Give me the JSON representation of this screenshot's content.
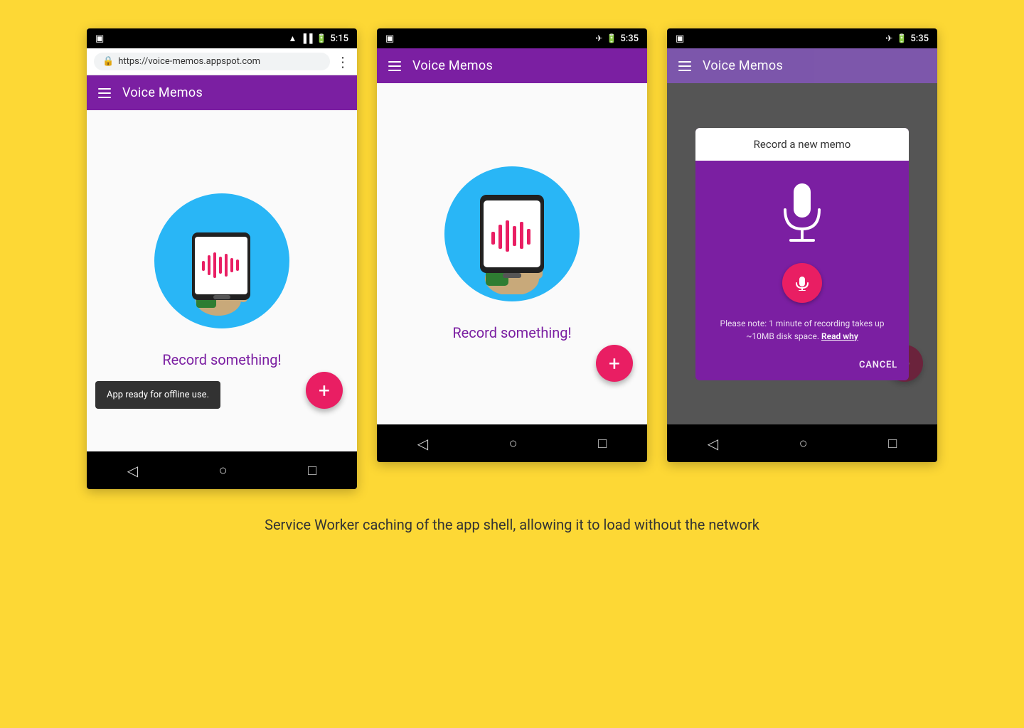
{
  "page": {
    "background": "#FDD835",
    "caption": "Service Worker caching of the app shell, allowing it to load without the network"
  },
  "phone1": {
    "statusBar": {
      "time": "5:15",
      "hasSim": true,
      "hasWifi": true,
      "hasBattery": true
    },
    "chromeBar": {
      "url": "https://voice-memos.appspot.com",
      "hasLock": true
    },
    "toolbar": {
      "title": "Voice Memos"
    },
    "content": {
      "recordLabel": "Record something!"
    },
    "snackbar": {
      "text": "App ready for offline use."
    },
    "fab": {
      "label": "+"
    },
    "nav": {
      "back": "◁",
      "home": "○",
      "recent": "□"
    }
  },
  "phone2": {
    "statusBar": {
      "time": "5:35",
      "hasAirplane": true,
      "hasBattery": true
    },
    "toolbar": {
      "title": "Voice Memos"
    },
    "content": {
      "recordLabel": "Record something!"
    },
    "fab": {
      "label": "+"
    },
    "nav": {
      "back": "◁",
      "home": "○",
      "recent": "□"
    }
  },
  "phone3": {
    "statusBar": {
      "time": "5:35",
      "hasAirplane": true,
      "hasBattery": true
    },
    "toolbar": {
      "title": "Voice Memos"
    },
    "dialog": {
      "title": "Record a new memo",
      "note": "Please note: 1 minute of recording takes up ~10MB disk space.",
      "noteLink": "Read why",
      "cancelLabel": "CANCEL"
    },
    "fab": {
      "label": "+"
    },
    "nav": {
      "back": "◁",
      "home": "○",
      "recent": "□"
    }
  }
}
